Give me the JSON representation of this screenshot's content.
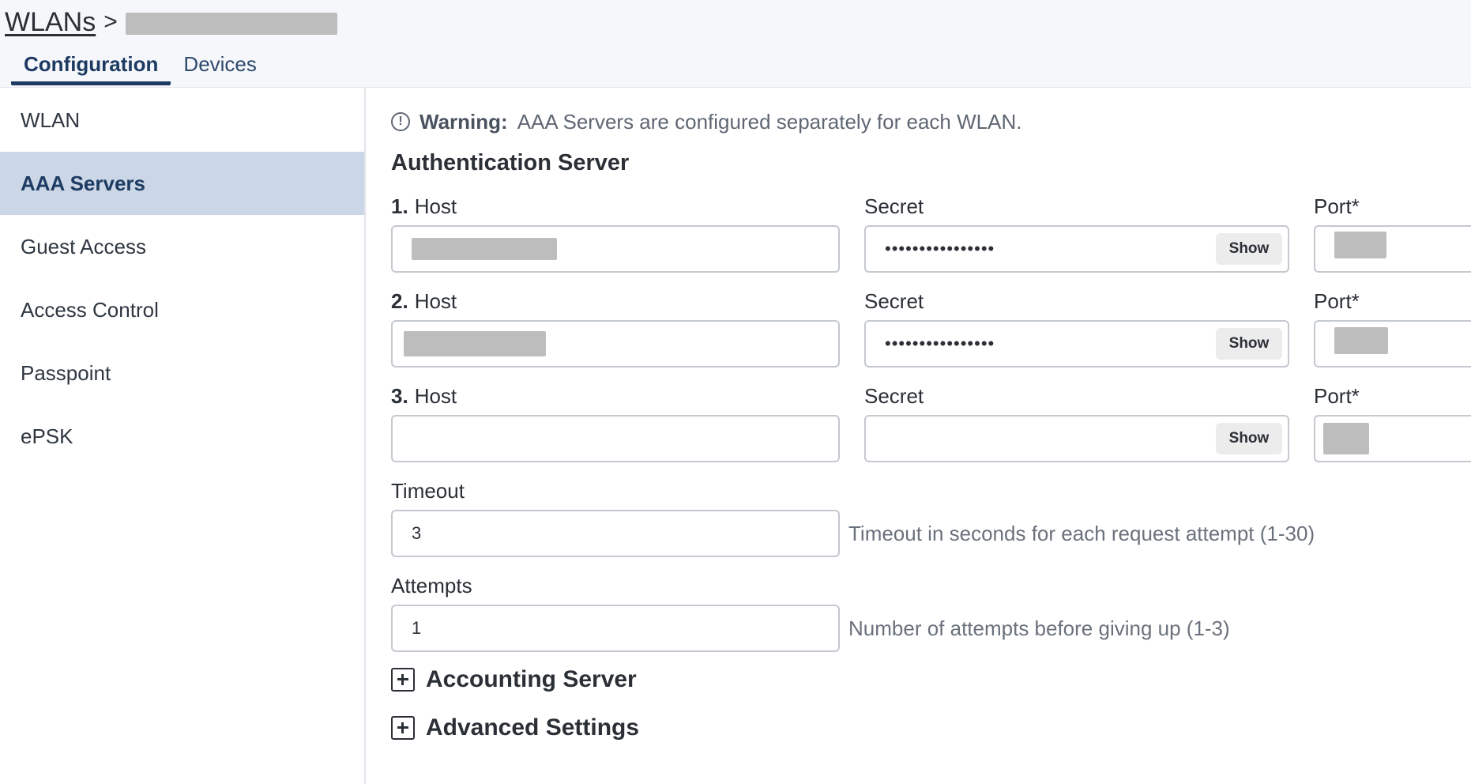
{
  "breadcrumb": {
    "root": "WLANs",
    "separator": ">"
  },
  "tabs": [
    {
      "label": "Configuration",
      "active": true
    },
    {
      "label": "Devices",
      "active": false
    }
  ],
  "sidebar": {
    "items": [
      {
        "label": "WLAN",
        "active": false
      },
      {
        "label": "AAA Servers",
        "active": true
      },
      {
        "label": "Guest Access",
        "active": false
      },
      {
        "label": "Access Control",
        "active": false
      },
      {
        "label": "Passpoint",
        "active": false
      },
      {
        "label": "ePSK",
        "active": false
      }
    ]
  },
  "warning": {
    "label": "Warning:",
    "text": "AAA Servers are configured separately for each WLAN."
  },
  "auth_server": {
    "title": "Authentication Server",
    "host_label": "Host",
    "secret_label": "Secret",
    "port_label": "Port*",
    "show_label": "Show",
    "servers": [
      {
        "number": "1.",
        "secret_value": "••••••••••••••••"
      },
      {
        "number": "2.",
        "secret_value": "••••••••••••••••"
      },
      {
        "number": "3.",
        "secret_value": ""
      }
    ]
  },
  "timeout": {
    "label": "Timeout",
    "value": "3",
    "hint": "Timeout in seconds for each request attempt (1-30)"
  },
  "attempts": {
    "label": "Attempts",
    "value": "1",
    "hint": "Number of attempts before giving up (1-3)"
  },
  "sections": {
    "accounting": "Accounting Server",
    "advanced": "Advanced Settings"
  },
  "colors": {
    "accent": "#1d3b62",
    "active_sidebar_bg": "#cbd6e6",
    "header_bg": "#f5f7fb"
  }
}
